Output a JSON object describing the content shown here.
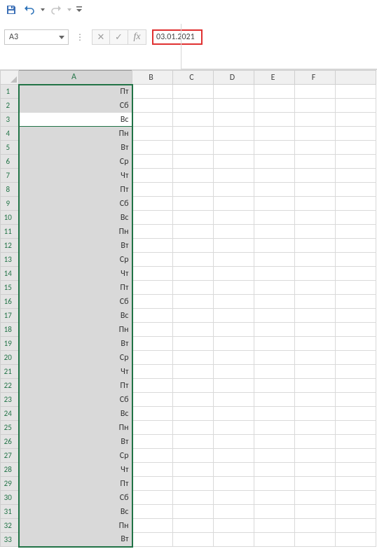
{
  "qat": {
    "save": "save-icon",
    "undo": "undo-icon",
    "redo": "redo-icon",
    "customize": "customize-dropdown"
  },
  "namebox": {
    "value": "A3"
  },
  "formula_bar": {
    "cancel": "✕",
    "enter": "✓",
    "fx": "fx",
    "value": "03.01.2021"
  },
  "columns": [
    "A",
    "B",
    "C",
    "D",
    "E",
    "F"
  ],
  "active_cell": "A3",
  "selection": "A1:A33",
  "rows": [
    {
      "n": 1,
      "a": "Пт"
    },
    {
      "n": 2,
      "a": "Сб"
    },
    {
      "n": 3,
      "a": "Вс"
    },
    {
      "n": 4,
      "a": "Пн"
    },
    {
      "n": 5,
      "a": "Вт"
    },
    {
      "n": 6,
      "a": "Ср"
    },
    {
      "n": 7,
      "a": "Чт"
    },
    {
      "n": 8,
      "a": "Пт"
    },
    {
      "n": 9,
      "a": "Сб"
    },
    {
      "n": 10,
      "a": "Вс"
    },
    {
      "n": 11,
      "a": "Пн"
    },
    {
      "n": 12,
      "a": "Вт"
    },
    {
      "n": 13,
      "a": "Ср"
    },
    {
      "n": 14,
      "a": "Чт"
    },
    {
      "n": 15,
      "a": "Пт"
    },
    {
      "n": 16,
      "a": "Сб"
    },
    {
      "n": 17,
      "a": "Вс"
    },
    {
      "n": 18,
      "a": "Пн"
    },
    {
      "n": 19,
      "a": "Вт"
    },
    {
      "n": 20,
      "a": "Ср"
    },
    {
      "n": 21,
      "a": "Чт"
    },
    {
      "n": 22,
      "a": "Пт"
    },
    {
      "n": 23,
      "a": "Сб"
    },
    {
      "n": 24,
      "a": "Вс"
    },
    {
      "n": 25,
      "a": "Пн"
    },
    {
      "n": 26,
      "a": "Вт"
    },
    {
      "n": 27,
      "a": "Ср"
    },
    {
      "n": 28,
      "a": "Чт"
    },
    {
      "n": 29,
      "a": "Пт"
    },
    {
      "n": 30,
      "a": "Сб"
    },
    {
      "n": 31,
      "a": "Вс"
    },
    {
      "n": 32,
      "a": "Пн"
    },
    {
      "n": 33,
      "a": "Вт"
    }
  ]
}
